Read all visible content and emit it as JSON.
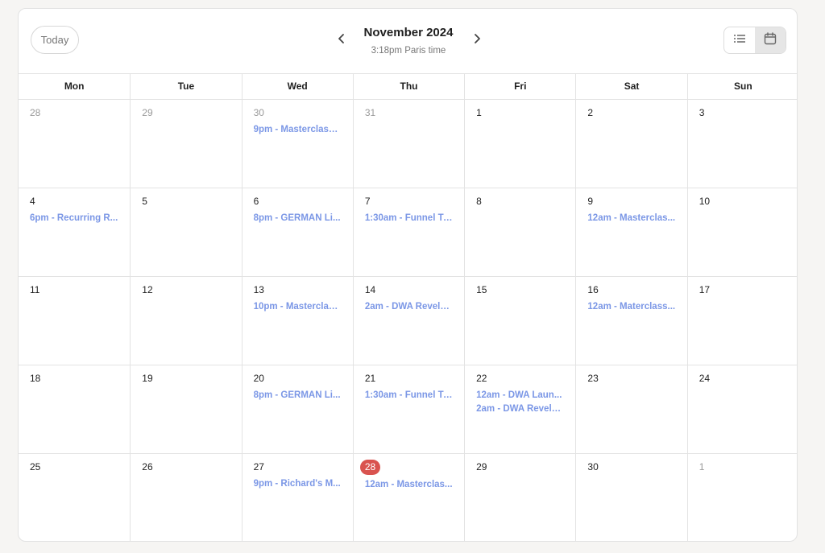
{
  "header": {
    "today_label": "Today",
    "month_title": "November 2024",
    "time_subtitle": "3:18pm Paris time",
    "prev_icon": "chevron-left-icon",
    "next_icon": "chevron-right-icon",
    "view_list_icon": "list-icon",
    "view_calendar_icon": "calendar-icon",
    "active_view": "calendar"
  },
  "weekdays": [
    "Mon",
    "Tue",
    "Wed",
    "Thu",
    "Fri",
    "Sat",
    "Sun"
  ],
  "colors": {
    "event": "#7b97e6",
    "today_badge": "#d9534f",
    "muted_day": "#9a9a9a"
  },
  "weeks": [
    [
      {
        "day": "28",
        "muted": true,
        "events": []
      },
      {
        "day": "29",
        "muted": true,
        "events": []
      },
      {
        "day": "30",
        "muted": true,
        "events": [
          "9pm - Masterclass..."
        ]
      },
      {
        "day": "31",
        "muted": true,
        "events": []
      },
      {
        "day": "1",
        "events": []
      },
      {
        "day": "2",
        "events": []
      },
      {
        "day": "3",
        "events": []
      }
    ],
    [
      {
        "day": "4",
        "events": [
          "6pm - Recurring R..."
        ]
      },
      {
        "day": "5",
        "events": []
      },
      {
        "day": "6",
        "events": [
          "8pm - GERMAN Li..."
        ]
      },
      {
        "day": "7",
        "events": [
          "1:30am - Funnel Tr..."
        ]
      },
      {
        "day": "8",
        "events": []
      },
      {
        "day": "9",
        "events": [
          "12am - Masterclas..."
        ]
      },
      {
        "day": "10",
        "events": []
      }
    ],
    [
      {
        "day": "11",
        "events": []
      },
      {
        "day": "12",
        "events": []
      },
      {
        "day": "13",
        "events": [
          "10pm - Masterclas..."
        ]
      },
      {
        "day": "14",
        "events": [
          "2am - DWA Revela..."
        ]
      },
      {
        "day": "15",
        "events": []
      },
      {
        "day": "16",
        "events": [
          "12am - Materclass..."
        ]
      },
      {
        "day": "17",
        "events": []
      }
    ],
    [
      {
        "day": "18",
        "events": []
      },
      {
        "day": "19",
        "events": []
      },
      {
        "day": "20",
        "events": [
          "8pm - GERMAN Li..."
        ]
      },
      {
        "day": "21",
        "events": [
          "1:30am - Funnel Tr..."
        ]
      },
      {
        "day": "22",
        "events": [
          "12am - DWA Laun...",
          "2am - DWA Revela..."
        ]
      },
      {
        "day": "23",
        "events": []
      },
      {
        "day": "24",
        "events": []
      }
    ],
    [
      {
        "day": "25",
        "events": []
      },
      {
        "day": "26",
        "events": []
      },
      {
        "day": "27",
        "events": [
          "9pm - Richard's M..."
        ]
      },
      {
        "day": "28",
        "today": true,
        "events": [
          "12am - Masterclas..."
        ]
      },
      {
        "day": "29",
        "events": []
      },
      {
        "day": "30",
        "events": []
      },
      {
        "day": "1",
        "muted": true,
        "events": []
      }
    ]
  ]
}
